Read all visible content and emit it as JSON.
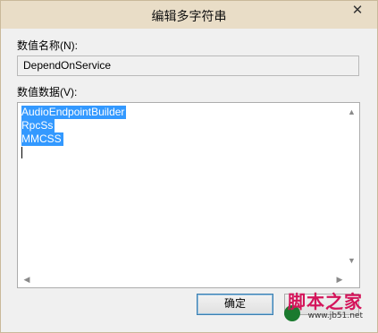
{
  "dialog": {
    "title": "编辑多字符串",
    "close_glyph": "✕"
  },
  "value_name": {
    "label": "数值名称(N):",
    "value": "DependOnService"
  },
  "value_data": {
    "label": "数值数据(V):",
    "lines": [
      "AudioEndpointBuilder",
      "RpcSs",
      "MMCSS"
    ]
  },
  "buttons": {
    "ok": "确定",
    "cancel": ""
  },
  "watermark": {
    "brand": "脚本之家",
    "url": "www.jb51.net"
  }
}
